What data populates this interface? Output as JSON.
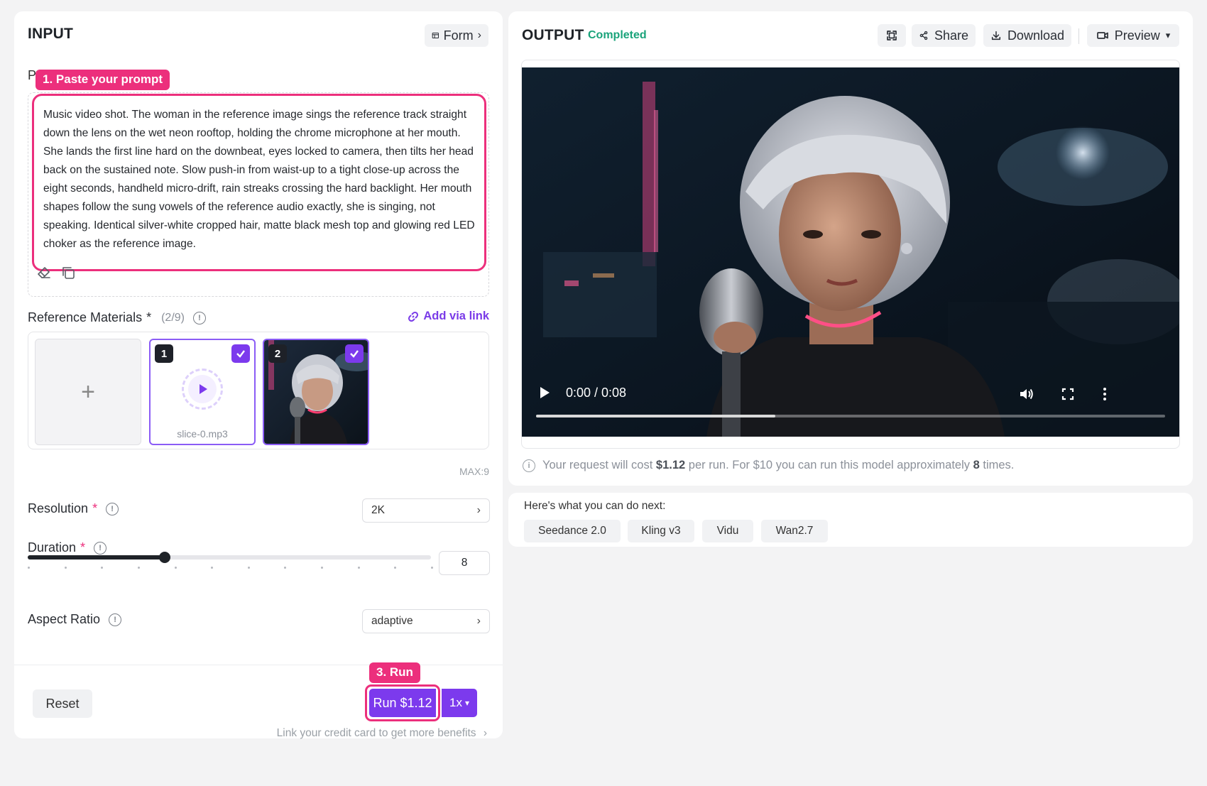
{
  "input": {
    "title": "INPUT",
    "form_label": "Form",
    "prompt": {
      "label": "P",
      "tag": "1. Paste your prompt",
      "text": "Music video shot. The woman in the reference image sings the reference track straight down the lens on the wet neon rooftop, holding the chrome microphone at her mouth. She lands the first line hard on the downbeat, eyes locked to camera, then tilts her head back on the sustained note. Slow push-in from waist-up to a tight close-up across the eight seconds, handheld micro-drift, rain streaks crossing the hard backlight. Her mouth shapes follow the sung vowels of the reference audio exactly, she is singing, not speaking. Identical silver-white cropped hair, matte black mesh top and glowing red LED choker as the reference image."
    },
    "reference": {
      "label": "Reference Materials",
      "required": "*",
      "count": "(2/9)",
      "add_link": "Add via link",
      "add_tile": "+",
      "items": [
        {
          "num": "1",
          "name": "slice-0.mp3",
          "type": "audio"
        },
        {
          "num": "2",
          "type": "image"
        }
      ],
      "max": "MAX:9"
    },
    "resolution": {
      "label": "Resolution",
      "required": "*",
      "value": "2K"
    },
    "duration": {
      "label": "Duration",
      "required": "*",
      "value": "8",
      "slider_fraction": 0.34
    },
    "aspect_ratio": {
      "label": "Aspect Ratio",
      "value": "adaptive"
    },
    "reset_label": "Reset",
    "run_tag": "3. Run",
    "run_label": "Run $1.12",
    "multiplier": "1x",
    "credit_link": "Link your credit card to get more benefits"
  },
  "output": {
    "title": "OUTPUT",
    "status": "Completed",
    "share_label": "Share",
    "download_label": "Download",
    "preview_label": "Preview",
    "video": {
      "time": "0:00 / 0:08",
      "progress": 0.38
    },
    "cost": {
      "pre": "Your request will cost",
      "price": "$1.12",
      "mid": "per run. For $10 you can run this model approximately",
      "times": "8",
      "post": "times."
    }
  },
  "next": {
    "title": "Here's what you can do next:",
    "models": [
      "Seedance 2.0",
      "Kling v3",
      "Vidu",
      "Wan2.7"
    ]
  },
  "colors": {
    "accent": "#7c3aed",
    "highlight": "#ec2f7c",
    "status": "#1aa37a"
  }
}
